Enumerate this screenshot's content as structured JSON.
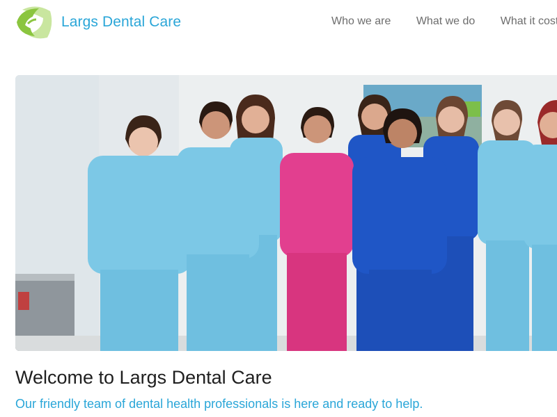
{
  "site": {
    "name": "Largs Dental Care",
    "logo_icon": "swirl-leaf-logo",
    "brand_blue": "#2aa6d8",
    "brand_green": "#8bc53f"
  },
  "nav": {
    "items": [
      {
        "label": "Who we are"
      },
      {
        "label": "What we do"
      },
      {
        "label": "What it costs"
      }
    ]
  },
  "hero": {
    "image_subject": "team-photo",
    "scrub_colors": [
      "#7cc8e6",
      "#e23f8f",
      "#1f56c6"
    ]
  },
  "main": {
    "heading": "Welcome to Largs Dental Care",
    "tagline": "Our friendly team of dental health professionals is here and ready to help."
  }
}
